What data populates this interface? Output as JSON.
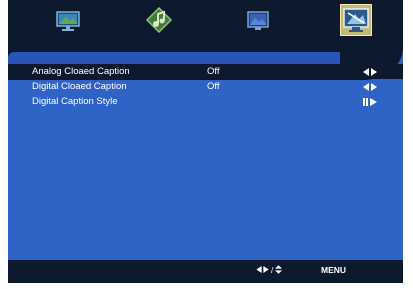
{
  "tabs": [
    {
      "name": "picture-tab",
      "icon": "monitor-icon",
      "active": false
    },
    {
      "name": "audio-tab",
      "icon": "audio-icon",
      "active": false
    },
    {
      "name": "channel-tab",
      "icon": "tv-icon",
      "active": false
    },
    {
      "name": "caption-tab",
      "icon": "caption-screen-icon",
      "active": true
    }
  ],
  "rows": [
    {
      "label": "Analog Cloaed Caption",
      "value": "Off",
      "control": "left-right-arrows-icon",
      "selected": true
    },
    {
      "label": "Digital Cloaed Caption",
      "value": "Off",
      "control": "left-right-arrows-icon",
      "selected": false
    },
    {
      "label": "Digital Caption Style",
      "value": "",
      "control": "enter-arrow-icon",
      "selected": false
    }
  ],
  "footer": {
    "nav_hint": "/",
    "menu_label": "MENU"
  },
  "colors": {
    "background": "#2f63c5",
    "bar": "#0d1a2e",
    "text": "#ffffff",
    "active_tab": "#c4ba77"
  }
}
